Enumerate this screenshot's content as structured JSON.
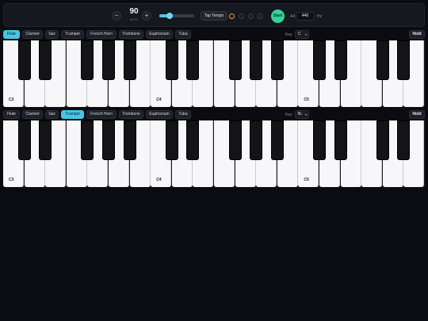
{
  "transport": {
    "bpm": "90",
    "bpm_label": "BPM",
    "decrement": "−",
    "increment": "+",
    "tempo_slider_fraction": 0.3,
    "tap_tempo": "Tap Tempo",
    "beats": 4,
    "active_beat": 0,
    "start": "Start",
    "a4_label": "A4",
    "a4_value": "440",
    "hz_label": "Hz"
  },
  "colors": {
    "accent": "#46c6e6",
    "start": "#34d39a",
    "beat_active": "#f0a030",
    "background": "#0b0c12"
  },
  "rows": [
    {
      "instruments": [
        "Flute",
        "Clarinet",
        "Sax",
        "Trumpet",
        "French Horn",
        "Trombone",
        "Euphonium",
        "Tuba"
      ],
      "active_instrument": 0,
      "key_label": "Key",
      "key_value": "C",
      "hold": "Hold"
    },
    {
      "instruments": [
        "Flute",
        "Clarinet",
        "Sax",
        "Trumpet",
        "French Horn",
        "Trombone",
        "Euphonium",
        "Tuba"
      ],
      "active_instrument": 3,
      "key_label": "Key",
      "key_value": "B♭",
      "hold": "Hold"
    }
  ],
  "keyboard": {
    "white_key_count": 20,
    "black_after_white": [
      0,
      1,
      3,
      4,
      5,
      7,
      8,
      10,
      11,
      12,
      14,
      15,
      17,
      18
    ],
    "labels": {
      "0": "C3",
      "7": "C4",
      "14": "C5"
    }
  }
}
